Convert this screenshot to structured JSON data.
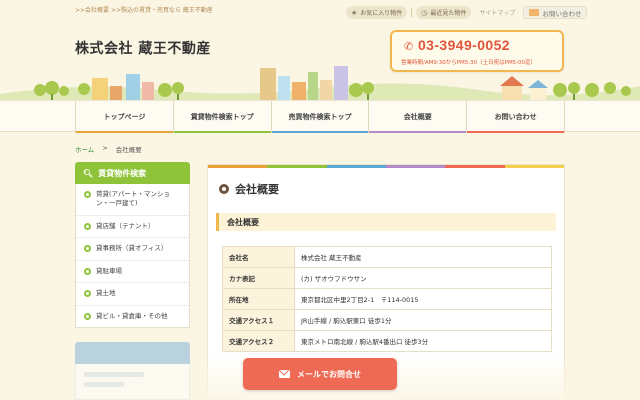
{
  "header": {
    "tagline": ">>会社概要 >>駒込の賃貸・売買なら 蔵王不動産",
    "favorites_label": "お気に入り物件",
    "recent_label": "最近見た物件",
    "sitemap_label": "サイトマップ",
    "contact_label": "お問い合わせ",
    "company_name": "株式会社 蔵王不動産",
    "phone": "03-3949-0052",
    "hours": "営業時間/AM9:30からPM5:30（土日祝はPM5:00迄）"
  },
  "nav": {
    "items": [
      {
        "label": "トップページ",
        "color": "#e8a23c"
      },
      {
        "label": "賃貸物件検索トップ",
        "color": "#8fc43a"
      },
      {
        "label": "売買物件検索トップ",
        "color": "#5aa8d8"
      },
      {
        "label": "会社概要",
        "color": "#b58acb"
      },
      {
        "label": "お問い合わせ",
        "color": "#ef6a55"
      }
    ]
  },
  "breadcrumb": {
    "home": "ホーム",
    "separator": ">",
    "current": "会社概要"
  },
  "sidebar": {
    "title": "賃貸物件検索",
    "items": [
      "賃貸(アパート・マンション・一戸建て)",
      "貸店舗（テナント）",
      "貸事務所（貸オフィス）",
      "貸駐車場",
      "貸土地",
      "貸ビル・貸倉庫・その他"
    ]
  },
  "main": {
    "title": "会社概要",
    "section_title": "会社概要",
    "rows": [
      {
        "key": "会社名",
        "value": "株式会社 蔵王不動産"
      },
      {
        "key": "カナ表記",
        "value": "(カ) ザオウフドウサン"
      },
      {
        "key": "所在地",
        "value": "東京都北区中里2丁目2-1　〒114-0015"
      },
      {
        "key": "交通アクセス１",
        "value": "JR山手線 / 駒込駅東口 徒歩1分"
      },
      {
        "key": "交通アクセス２",
        "value": "東京メトロ南北線 / 駒込駅4番出口 徒歩3分"
      }
    ]
  },
  "floating": {
    "mail_button": "メールでお問合せ"
  },
  "colors": {
    "accent_green": "#8fc43a",
    "phone_red": "#e0553b",
    "mail_button": "#ef6a55",
    "background": "#fbf6e4"
  }
}
